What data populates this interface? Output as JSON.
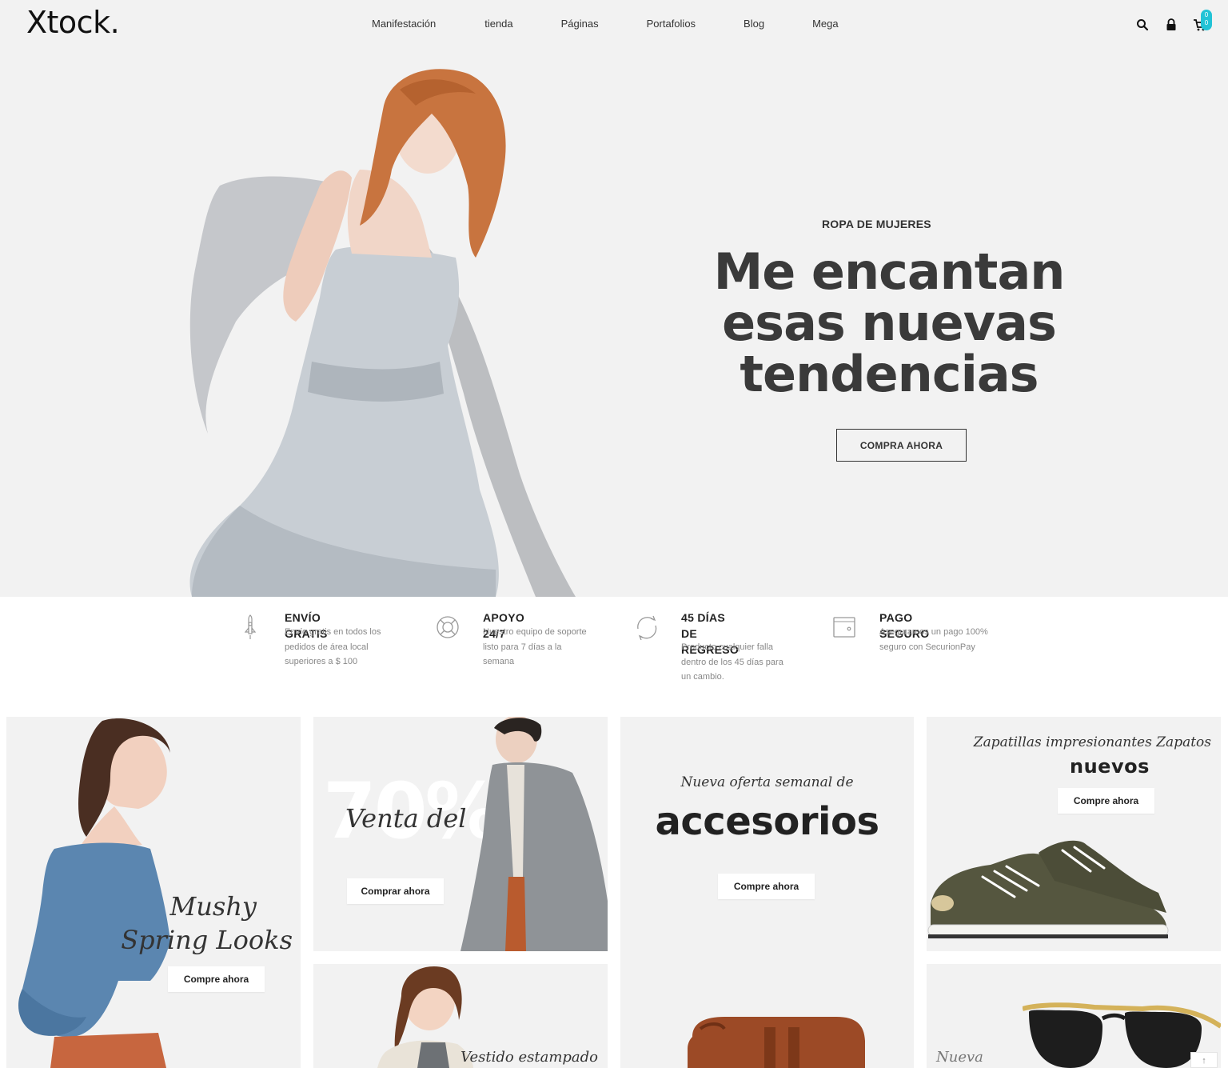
{
  "header": {
    "logo": "Xtock.",
    "nav": [
      "Manifestación",
      "tienda",
      "Páginas",
      "Portafolios",
      "Blog",
      "Mega"
    ],
    "cart_count": "0",
    "icons": [
      "search-icon",
      "lock-icon",
      "cart-icon"
    ],
    "accent_color": "#22c3d6"
  },
  "hero": {
    "eyebrow": "ROPA DE MUJERES",
    "title_line1": "Me encantan",
    "title_line2": "esas nuevas",
    "title_line3": "tendencias",
    "button": "COMPRA AHORA"
  },
  "features": [
    {
      "icon": "rocket-icon",
      "title": "ENVÍO GRATIS",
      "desc1": "Envío gratis en todos los",
      "desc2": "pedidos de área local",
      "desc3": "superiores a $ 100"
    },
    {
      "icon": "lifebuoy-icon",
      "title": "APOYO 24/7",
      "desc1": "Nuestro equipo de soporte",
      "desc2": "listo para 7 días a la",
      "desc3": "semana"
    },
    {
      "icon": "return-icon",
      "title_line1": "45 DÍAS DE",
      "title_line2": "REGRESO",
      "desc1": "Producto cualquier falla",
      "desc2": "dentro de los 45 días para",
      "desc3": "un cambio."
    },
    {
      "icon": "wallet-icon",
      "title": "PAGO SEGURO",
      "desc1": "Aseguramos un pago 100%",
      "desc2": "seguro con SecurionPay"
    }
  ],
  "banners": {
    "mushy": {
      "line1": "Mushy",
      "line2": "Spring Looks",
      "button": "Compre ahora"
    },
    "sale": {
      "big": "70%",
      "text": "Venta del",
      "button": "Comprar ahora"
    },
    "dress": {
      "text": "Vestido estampado"
    },
    "accessories": {
      "subtitle": "Nueva oferta semanal de",
      "title": "accesorios",
      "button": "Compre ahora"
    },
    "sneakers": {
      "subtitle": "Zapatillas impresionantes Zapatos",
      "title": "nuevos",
      "button": "Compre ahora"
    },
    "glasses": {
      "text": "Nueva"
    }
  }
}
